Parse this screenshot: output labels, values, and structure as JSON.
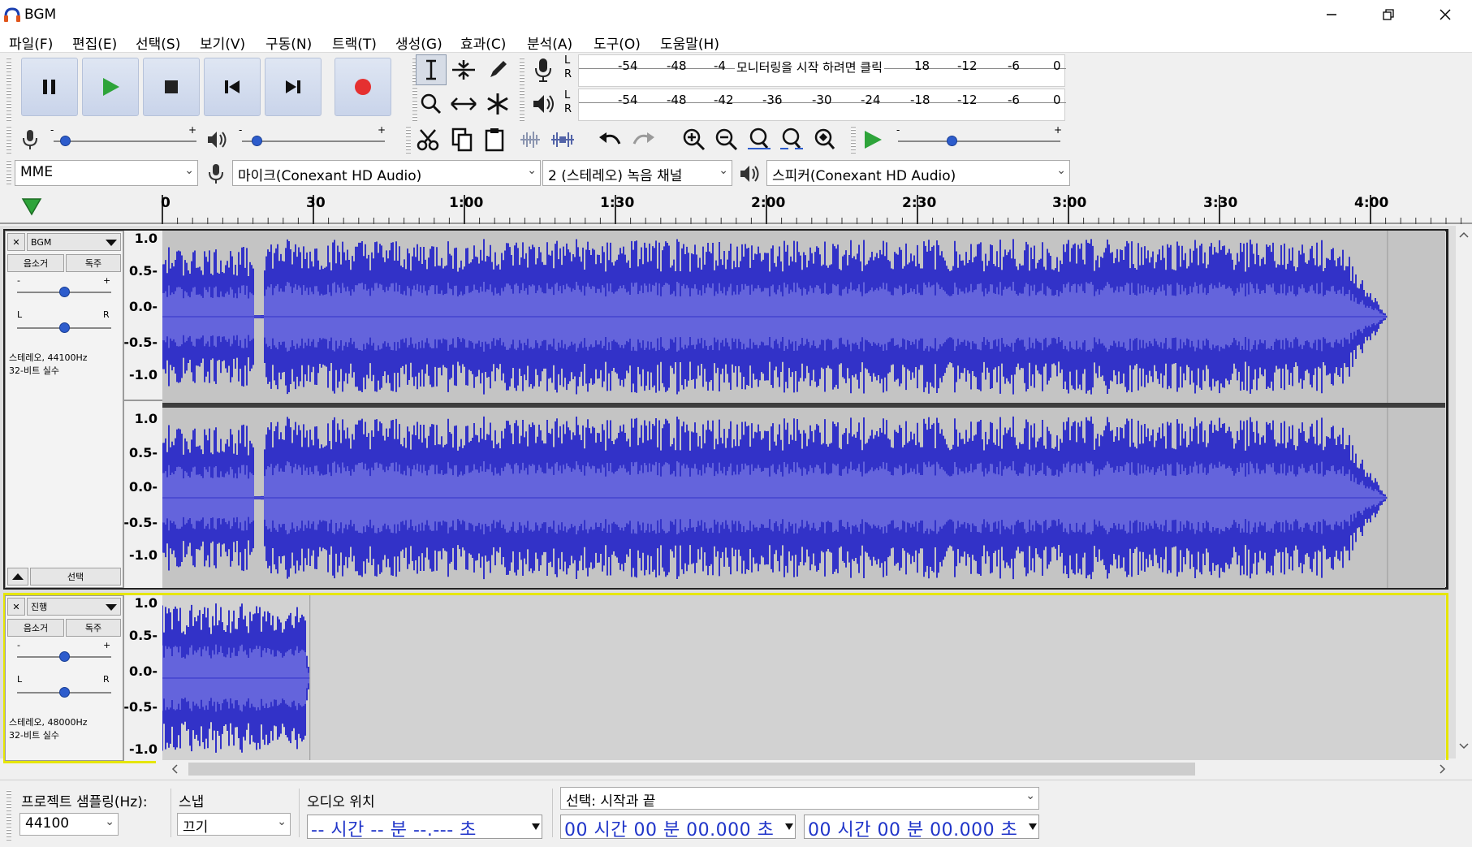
{
  "window": {
    "title": "BGM"
  },
  "menu": [
    "파일(F)",
    "편집(E)",
    "선택(S)",
    "보기(V)",
    "구동(N)",
    "트랙(T)",
    "생성(G)",
    "효과(C)",
    "분석(A)",
    "도구(O)",
    "도움말(H)"
  ],
  "meters": {
    "record_channels": [
      "L",
      "R"
    ],
    "play_channels": [
      "L",
      "R"
    ],
    "record_ticks": [
      "-54",
      "-48",
      "-4"
    ],
    "record_message": "모니터링을 시작 하려면 클릭",
    "record_ticks_right": [
      "18",
      "-12",
      "-6",
      "0"
    ],
    "play_ticks": [
      "-54",
      "-48",
      "-42",
      "-36",
      "-30",
      "-24",
      "-18",
      "-12",
      "-6",
      "0"
    ]
  },
  "sliders": {
    "record_volume_level": 0.08,
    "play_volume_level": 0.1,
    "playback_speed_level": 0.33,
    "record_minus": "-",
    "record_plus": "+",
    "play_minus": "-",
    "play_plus": "+",
    "speed_minus": "-",
    "speed_plus": "+"
  },
  "device": {
    "host": "MME",
    "input": "마이크(Conexant HD Audio)",
    "channels": "2 (스테레오) 녹음 채널",
    "output": "스피커(Conexant HD Audio)"
  },
  "timeline": {
    "labels": [
      "0",
      "30",
      "1:00",
      "1:30",
      "2:00",
      "2:30",
      "3:00",
      "3:30",
      "4:00"
    ]
  },
  "tracks": [
    {
      "name": "BGM",
      "mute": "음소거",
      "solo": "독주",
      "gain_minus": "-",
      "gain_plus": "+",
      "pan_left": "L",
      "pan_right": "R",
      "info1": "스테레오, 44100Hz",
      "info2": "32-비트 실수",
      "select": "선택",
      "gain_level": 0.5,
      "pan_level": 0.5,
      "scale": [
        "1.0",
        "0.5-",
        "0.0-",
        "-0.5-",
        "-1.0"
      ],
      "duration_fraction": 0.955,
      "clip_gap_fraction": 0.08
    },
    {
      "name": "진행",
      "mute": "음소거",
      "solo": "독주",
      "gain_minus": "-",
      "gain_plus": "+",
      "pan_left": "L",
      "pan_right": "R",
      "info1": "스테레오, 48000Hz",
      "info2": "32-비트 실수",
      "gain_level": 0.5,
      "pan_level": 0.5,
      "scale": [
        "1.0",
        "0.5-",
        "0.0-",
        "-0.5-",
        "-1.0"
      ],
      "duration_fraction": 0.115
    }
  ],
  "status": {
    "rate_label": "프로젝트 샘플링(Hz):",
    "rate_value": "44100",
    "snap_label": "스냅",
    "snap_value": "끄기",
    "audio_pos_label": "오디오 위치",
    "audio_pos_value": "-- 시간 -- 분 --.--- 초",
    "selection_label": "선택: 시작과 끝",
    "sel_start": "00 시간 00 분 00.000 초",
    "sel_end": "00 시간 00 분 00.000 초"
  },
  "colors": {
    "wave": "#3232c8",
    "wave_rms": "#6464dc",
    "selected_border": "#e6e600",
    "record": "#e53030"
  }
}
